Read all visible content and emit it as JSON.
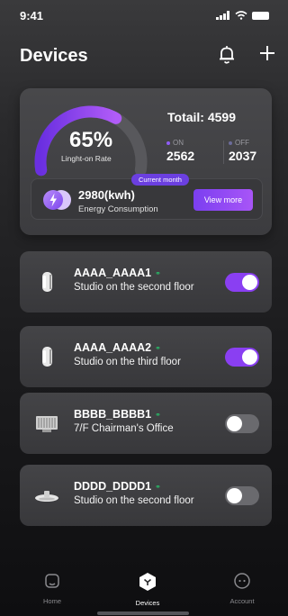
{
  "status_bar": {
    "time": "9:41"
  },
  "header": {
    "title": "Devices"
  },
  "overview": {
    "rate_value": "65%",
    "rate_label": "Linght-on Rate",
    "rate_fraction": 0.65,
    "total": "Totail: 4599",
    "on_label": "ON",
    "on_value": "2562",
    "off_label": "OFF",
    "off_value": "2037",
    "month_tag": "Current month",
    "energy_value": "2980(kwh)",
    "energy_label": "Energy Consumption",
    "view_more": "View more"
  },
  "devices": [
    {
      "name": "AAAA_AAAA1",
      "location": "Studio on the second floor",
      "on": true,
      "icon": "cylinder-lamp-icon"
    },
    {
      "name": "AAAA_AAAA2",
      "location": "Studio on the third floor",
      "on": true,
      "icon": "cylinder-lamp-icon"
    },
    {
      "name": "BBBB_BBBB1",
      "location": "7/F Chairman's Office",
      "on": false,
      "icon": "floodlight-icon"
    },
    {
      "name": "DDDD_DDDD1",
      "location": "Studio on the second floor",
      "on": false,
      "icon": "highbay-lamp-icon"
    }
  ],
  "tabs": [
    {
      "label": "Home",
      "active": false
    },
    {
      "label": "Devices",
      "active": true
    },
    {
      "label": "Account",
      "active": false
    }
  ],
  "colors": {
    "accent": "#8a3ff2",
    "online": "#27c26b"
  }
}
